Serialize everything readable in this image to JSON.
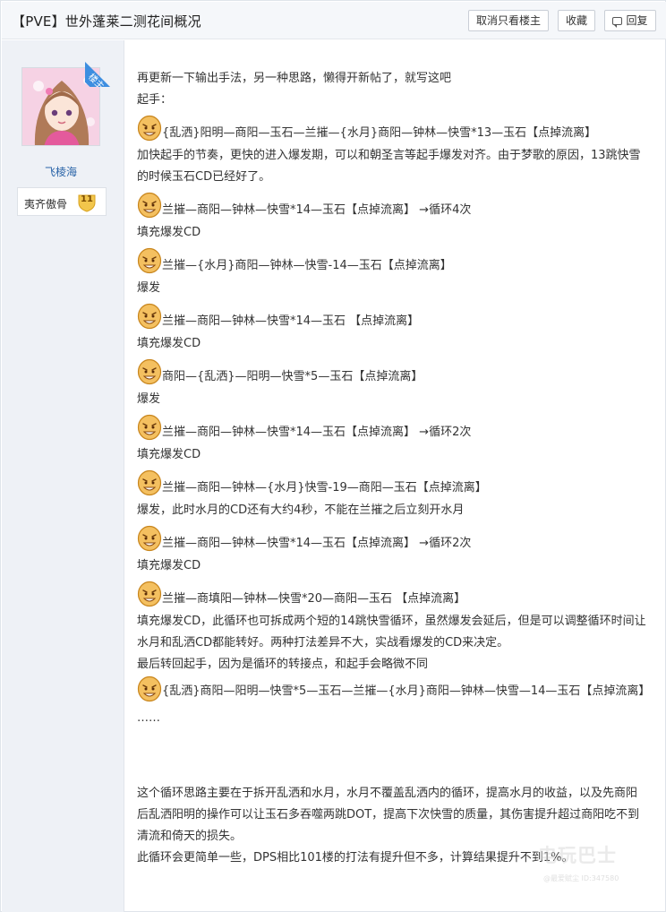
{
  "thread": {
    "title": "【PVE】世外蓬莱二测花间概况",
    "buttons": {
      "only_op": "取消只看楼主",
      "favorite": "收藏",
      "reply": "回复"
    }
  },
  "author": {
    "badge": "楼主",
    "name": "飞棱海",
    "medal_label": "夷齐傲骨",
    "medal_level": "11"
  },
  "colors": {
    "link_blue": "#2a64a8",
    "ribbon_blue": "#3d8ee0",
    "sidebar_bg": "#eef1f6"
  },
  "post": {
    "l1": "再更新一下输出手法，另一种思路，懒得开新帖了，就写这吧",
    "l2": "起手：",
    "e1": "{乱洒}阳明—商阳—玉石—兰摧—{水月}商阳—钟林—快雪*13—玉石【点掉流离】",
    "p1": "加快起手的节奏，更快的进入爆发期，可以和朝圣言等起手爆发对齐。由于梦歌的原因，13跳快雪的时候玉石CD已经好了。",
    "e2": "兰摧—商阳—钟林—快雪*14—玉石【点掉流离】 →循环4次",
    "l3": "填充爆发CD",
    "e3": "兰摧—{水月}商阳—钟林—快雪-14—玉石【点掉流离】",
    "l4": "爆发",
    "e4": "兰摧—商阳—钟林—快雪*14—玉石 【点掉流离】",
    "l5": "填充爆发CD",
    "e5": "商阳—{乱洒}—阳明—快雪*5—玉石【点掉流离】",
    "l6": "爆发",
    "e6": "兰摧—商阳—钟林—快雪*14—玉石【点掉流离】 →循环2次",
    "l7": "填充爆发CD",
    "e7": "兰摧—商阳—钟林—{水月}快雪-19—商阳—玉石【点掉流离】",
    "l8": "爆发，此时水月的CD还有大约4秒，不能在兰摧之后立刻开水月",
    "e8": "兰摧—商阳—钟林—快雪*14—玉石【点掉流离】 →循环2次",
    "l9": "填充爆发CD",
    "e9": "兰摧—商填阳—钟林—快雪*20—商阳—玉石 【点掉流离】",
    "p2": "填充爆发CD，此循环也可拆成两个短的14跳快雪循环，虽然爆发会延后，但是可以调整循环时间让水月和乱洒CD都能转好。两种打法差异不大，实战看爆发的CD来决定。",
    "l10": "最后转回起手，因为是循环的转接点，和起手会略微不同",
    "e10": "{乱洒}商阳—阳明—快雪*5—玉石—兰摧—{水月}商阳—钟林—快雪—14—玉石【点掉流离】",
    "l11": "……",
    "p3": "这个循环思路主要在于拆开乱洒和水月，水月不覆盖乱洒内的循环，提高水月的收益，以及先商阳后乱洒阳明的操作可以让玉石多吞噬两跳DOT，提高下次快雪的质量，其伤害提升超过商阳吃不到清流和倚天的损失。",
    "l12": "此循环会更简单一些，DPS相比101楼的打法有提升但不多，计算结果提升不到1%。"
  },
  "watermark": {
    "brand": "电玩巴士",
    "sub": "@最爱赋尘 ID:347580"
  }
}
